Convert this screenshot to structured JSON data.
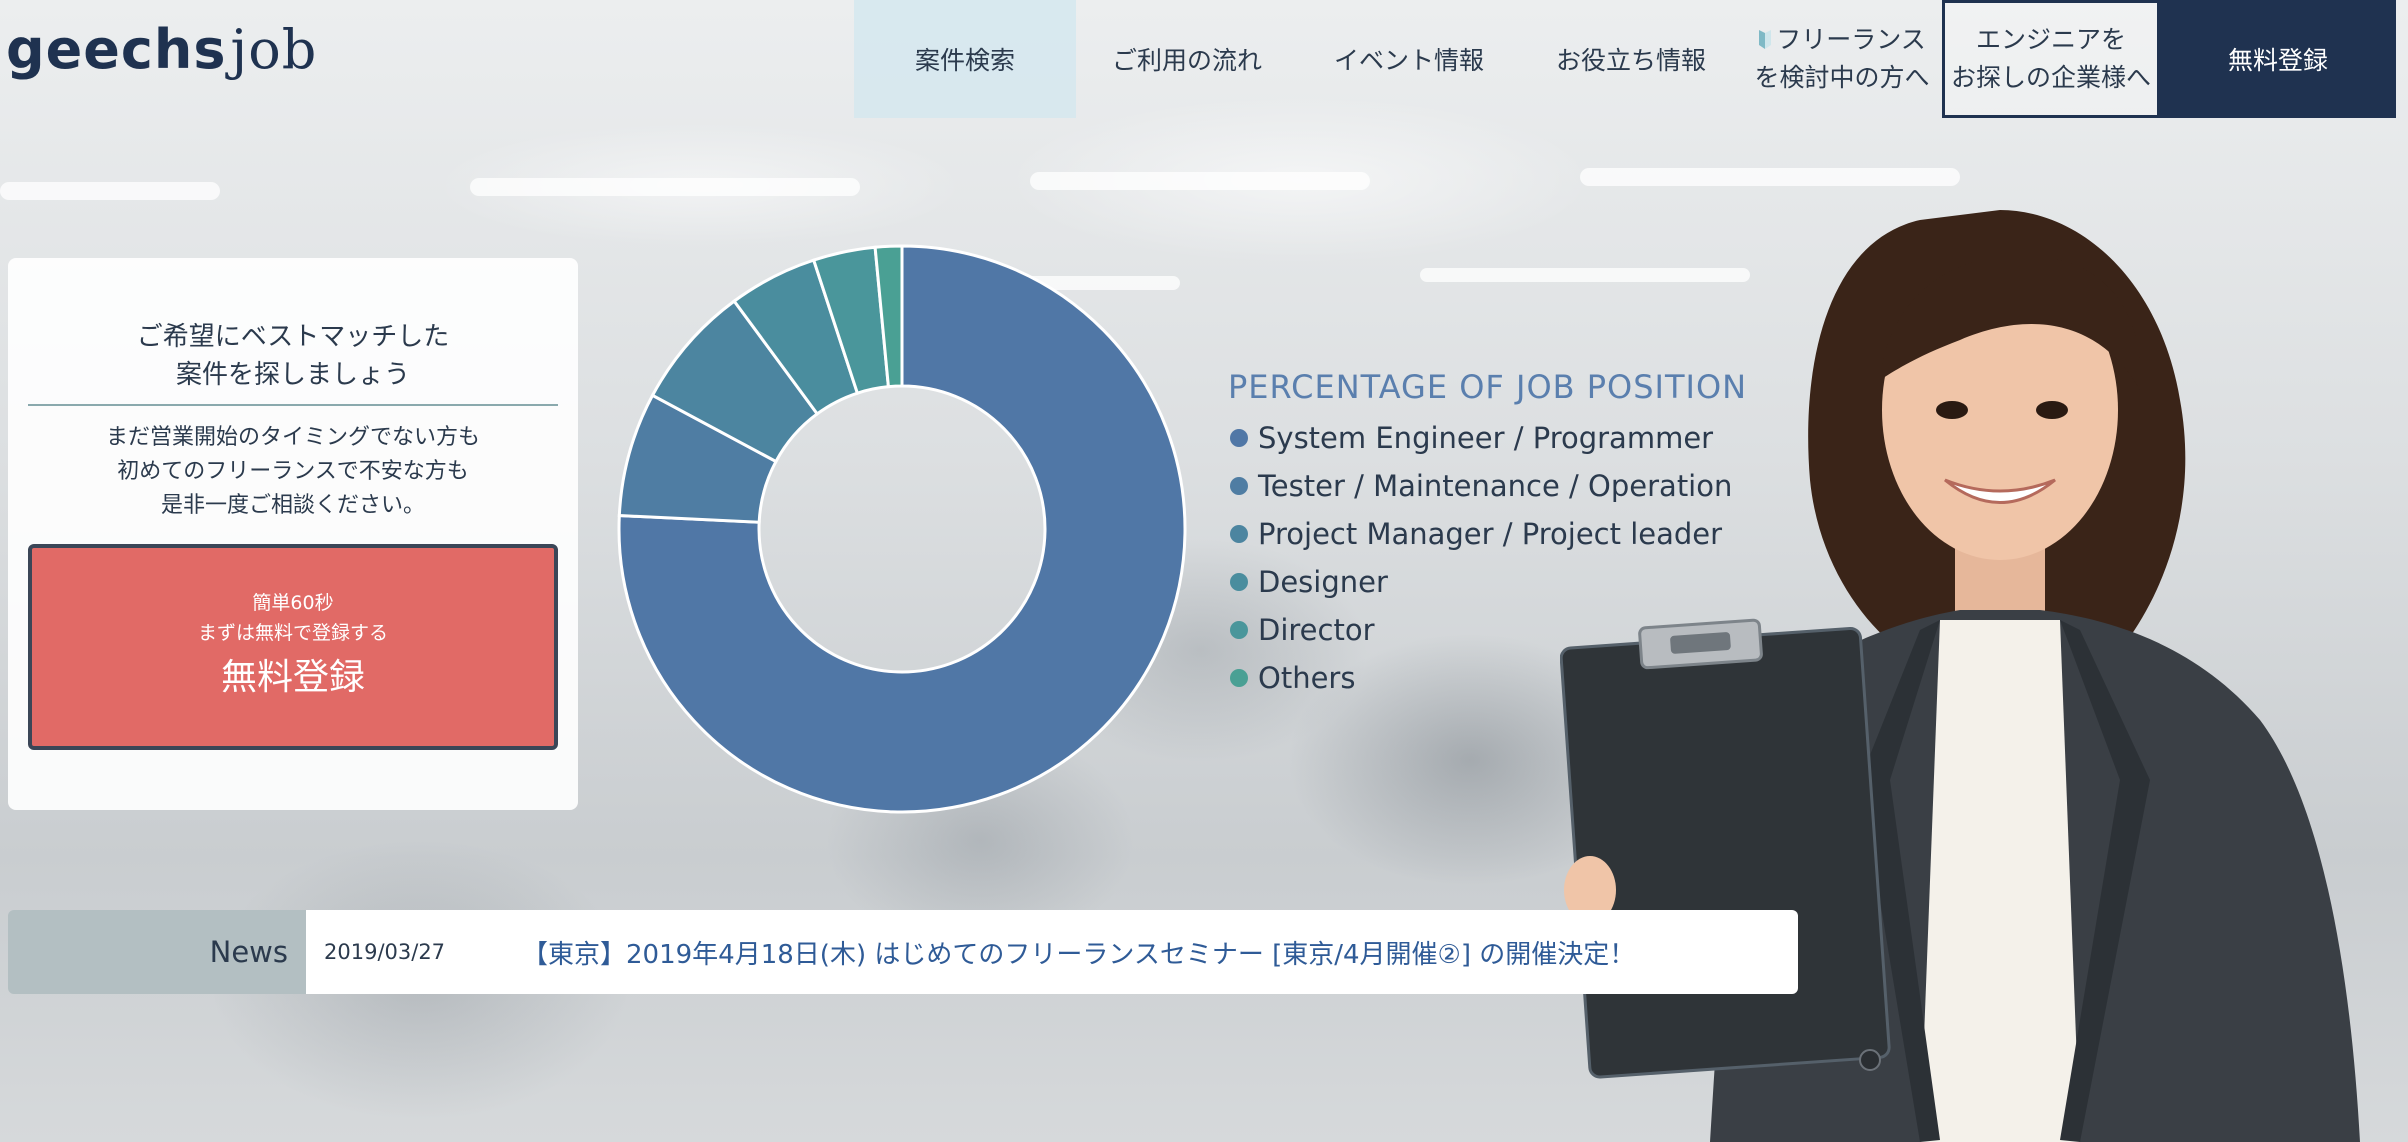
{
  "brand": {
    "logo_main": "geechs",
    "logo_sub": "job"
  },
  "nav": {
    "items": [
      {
        "label": "案件検索",
        "active": true
      },
      {
        "label": "ご利用の流れ"
      },
      {
        "label": "イベント情報"
      },
      {
        "label": "お役立ち情報"
      }
    ],
    "freelance": {
      "line1": "フリーランス",
      "line2": "を検討中の方へ"
    },
    "company": {
      "line1": "エンジニアを",
      "line2": "お探しの企業様へ"
    },
    "register": "無料登録"
  },
  "card": {
    "heading": "ご希望にベストマッチした\n案件を探しましょう",
    "body": "まだ営業開始のタイミングでない方も\n初めてのフリーランスで不安な方も\n是非一度ご相談ください。",
    "signup_line1": "簡単60秒",
    "signup_line2": "まずは無料で登録する",
    "signup_button": "無料登録"
  },
  "chart_data": {
    "type": "pie",
    "donut": true,
    "title": "PERCENTAGE OF JOB POSITION",
    "categories": [
      "System Engineer / Programmer",
      "Tester / Maintenance / Operation",
      "Project Manager / Project leader",
      "Designer",
      "Director",
      "Others"
    ],
    "values": [
      75,
      7,
      7,
      5,
      3.5,
      1.5
    ],
    "colors": [
      "#5077a6",
      "#4f7da3",
      "#4c85a0",
      "#4a8d9e",
      "#4a969b",
      "#4aa094"
    ],
    "legend_position": "right"
  },
  "news": {
    "label": "News",
    "date": "2019/03/27",
    "headline": "【東京】2019年4月18日(木) はじめてのフリーランスセミナー [東京/4月開催②] の開催決定！"
  }
}
